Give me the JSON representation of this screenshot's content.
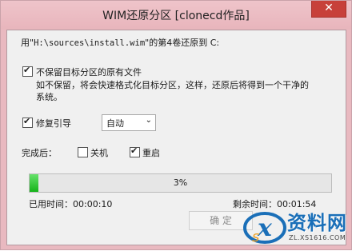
{
  "window": {
    "title": "WIM还原分区  [clonecd作品]",
    "close_glyph": "✕"
  },
  "info_line": {
    "prefix": "用\"",
    "path": "H:\\sources\\install.wim",
    "suffix": "\"的第4卷还原到 C:"
  },
  "options": {
    "keep_files": {
      "label": "不保留目标分区的原有文件",
      "checked": true,
      "description_line1": "如不保留，将会快速格式化目标分区，这样，还原后将得到一个干净的",
      "description_line2": "系统。"
    },
    "repair_boot": {
      "label": "修复引导",
      "checked": true,
      "select_value": "自动"
    }
  },
  "after_completion": {
    "label": "完成后：",
    "shutdown_label": "关机",
    "shutdown_checked": false,
    "restart_label": "重启",
    "restart_checked": true
  },
  "progress": {
    "percent": 3,
    "percent_text": "3%"
  },
  "timing": {
    "elapsed_label": "已用时间：",
    "elapsed_value": "00:00:10",
    "remaining_label": "剩余时间：",
    "remaining_value": "00:01:54"
  },
  "buttons": {
    "ok_label": "确 定"
  },
  "watermark": {
    "text": "资料网",
    "url": "ZL.XS1616.COM"
  },
  "colors": {
    "title_bg": "#e9b9c0",
    "client_bg": "#f0f0f0",
    "progress_fill": "#2cc42f",
    "close_red": "#c7403a",
    "watermark_blue": "#1a6fb8"
  }
}
